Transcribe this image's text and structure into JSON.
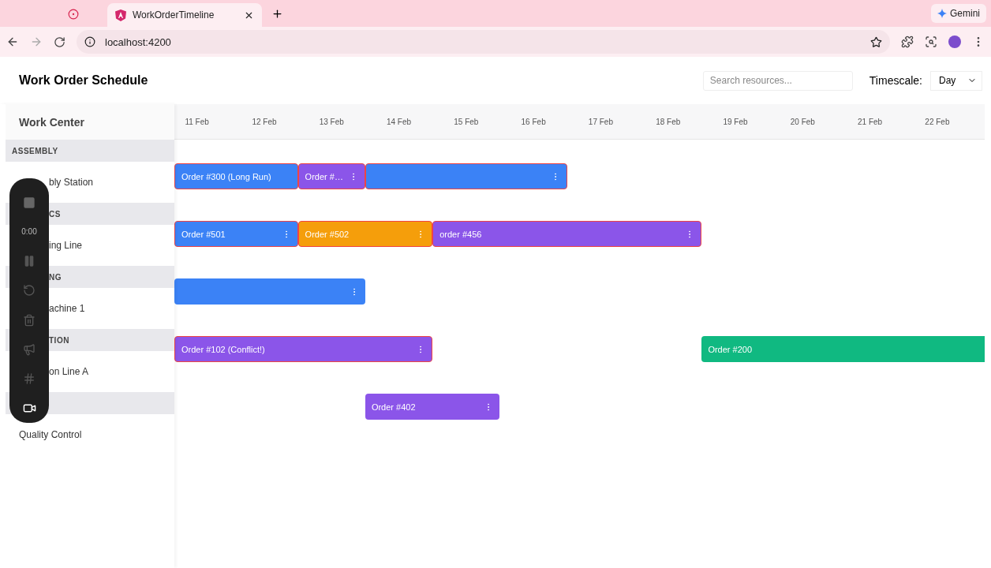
{
  "browser": {
    "tabs": [
      {
        "title": "WorkOrderTimeline",
        "selected": true
      }
    ],
    "url": "localhost:4200",
    "assistant": "Gemini"
  },
  "header": {
    "title": "Work Order Schedule",
    "search": {
      "placeholder": "Search resources..."
    },
    "timescale": {
      "label": "Timescale:",
      "value": "Day"
    }
  },
  "sidebar": {
    "heading": "Work Center",
    "groups": [
      {
        "name": "ASSEMBLY",
        "name_covered": false,
        "item": "bly Station",
        "item_covered": true
      },
      {
        "name": "CS",
        "name_covered": true,
        "item": "ing Line",
        "item_covered": true
      },
      {
        "name": "NG",
        "name_covered": true,
        "item": "achine 1",
        "item_covered": true
      },
      {
        "name": "TION",
        "name_covered": true,
        "item": "on Line A",
        "item_covered": true
      },
      {
        "item": "Quality Control",
        "item_covered": false
      }
    ]
  },
  "timeline": {
    "dates": [
      "11 Feb",
      "12 Feb",
      "13 Feb",
      "14 Feb",
      "15 Feb",
      "16 Feb",
      "17 Feb",
      "18 Feb",
      "19 Feb",
      "20 Feb",
      "21 Feb",
      "22 Feb"
    ],
    "rows": [
      {
        "bars": [
          {
            "label": "Order #300 (Long Run)",
            "color": "#3b82f6",
            "conflict": true,
            "menu": false
          },
          {
            "label": "Order #…",
            "color": "#8b55e9",
            "conflict": true,
            "menu": true
          },
          {
            "color": "#3b82f6",
            "conflict": true,
            "menu": true
          }
        ]
      },
      {
        "bars": [
          {
            "label": "Order #501",
            "color": "#3b82f6",
            "conflict": true,
            "menu": true
          },
          {
            "label": "Order #502",
            "color": "#f59e0b",
            "conflict": true,
            "menu": true
          },
          {
            "label": "order #456",
            "color": "#8b55e9",
            "conflict": true,
            "menu": true
          }
        ]
      },
      {
        "bars": [
          {
            "color": "#3b82f6",
            "conflict": false,
            "menu": true
          }
        ]
      },
      {
        "bars": [
          {
            "label": "Order #102 (Conflict!)",
            "color": "#8b55e9",
            "conflict": true,
            "menu": true
          },
          {
            "label": "Order #200",
            "color": "#10b981",
            "conflict": false,
            "menu": false
          }
        ]
      },
      {
        "bars": [
          {
            "label": "Order #402",
            "color": "#8b55e9",
            "conflict": false,
            "menu": true
          }
        ]
      }
    ]
  },
  "recorder": {
    "timer": "0:00"
  }
}
